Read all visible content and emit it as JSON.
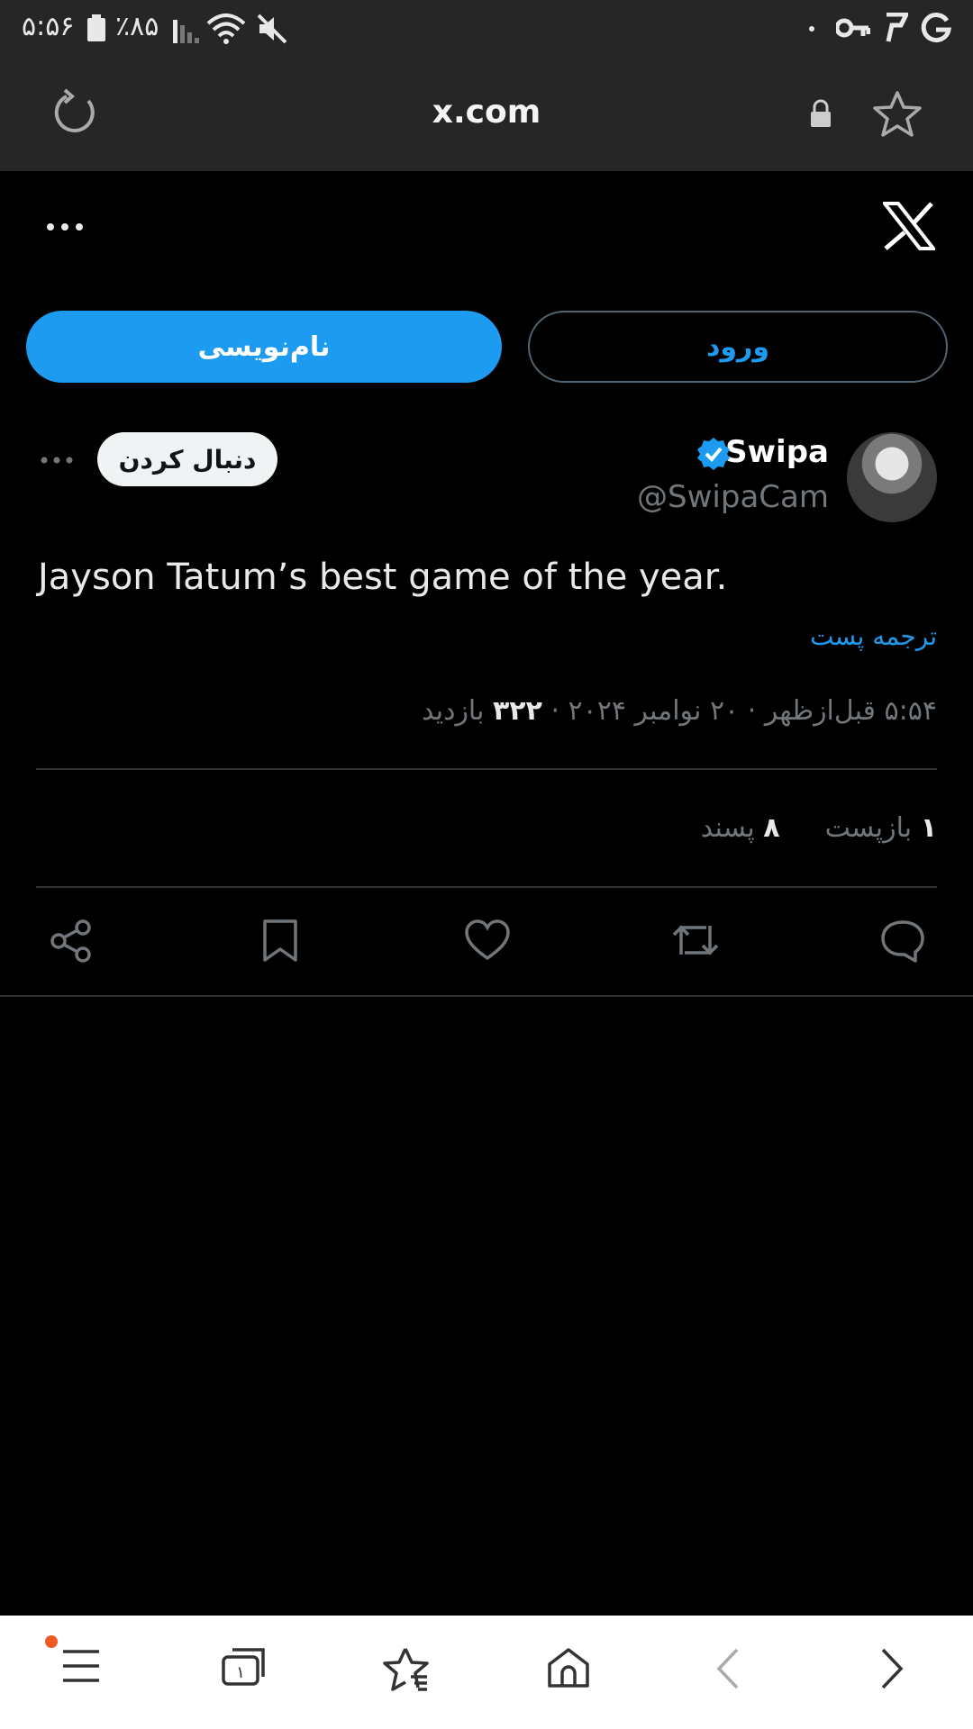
{
  "status_bar": {
    "time": "۵:۵۶",
    "battery_percent": "٪۸۵",
    "icons": [
      "battery-icon",
      "signal-icon",
      "wifi-icon",
      "mute-icon",
      "dot-icon",
      "key-icon",
      "p-app-icon",
      "google-icon"
    ]
  },
  "browser": {
    "url": "x.com",
    "reload_icon": "reload-icon",
    "lock_icon": "lock-icon",
    "bookmark_icon": "star-icon"
  },
  "header": {
    "logo": "x-logo-icon",
    "more_icon": "more-horizontal-icon"
  },
  "auth": {
    "signup_label": "نام‌نویسی",
    "login_label": "ورود"
  },
  "post": {
    "display_name": "Swipa",
    "username": "@SwipaCam",
    "verified": true,
    "follow_label": "دنبال کردن",
    "text": "Jayson Tatum’s best game of the year.",
    "translate_label": "ترجمه پست",
    "time": "۵:۵۴ قبل‌ازظهر",
    "date": "۲۰ نوامبر ۲۰۲۴",
    "separator": "·",
    "views_count": "۳۲۲",
    "views_label": "بازدید",
    "reposts_count": "۱",
    "reposts_label": "بازپست",
    "likes_count": "۸",
    "likes_label": "پسند",
    "actions": [
      "reply-icon",
      "repost-icon",
      "like-icon",
      "bookmark-icon",
      "share-icon"
    ]
  },
  "bottom_nav": {
    "items": [
      "menu-icon",
      "tabs-icon",
      "bookmarks-icon",
      "home-icon",
      "back-icon",
      "forward-icon"
    ],
    "tabs_count": "۱",
    "notification_color": "#f05a22"
  },
  "colors": {
    "accent": "#1d9bf0",
    "background": "#000000",
    "browser_bar": "#262626",
    "muted_text": "#71767b"
  }
}
